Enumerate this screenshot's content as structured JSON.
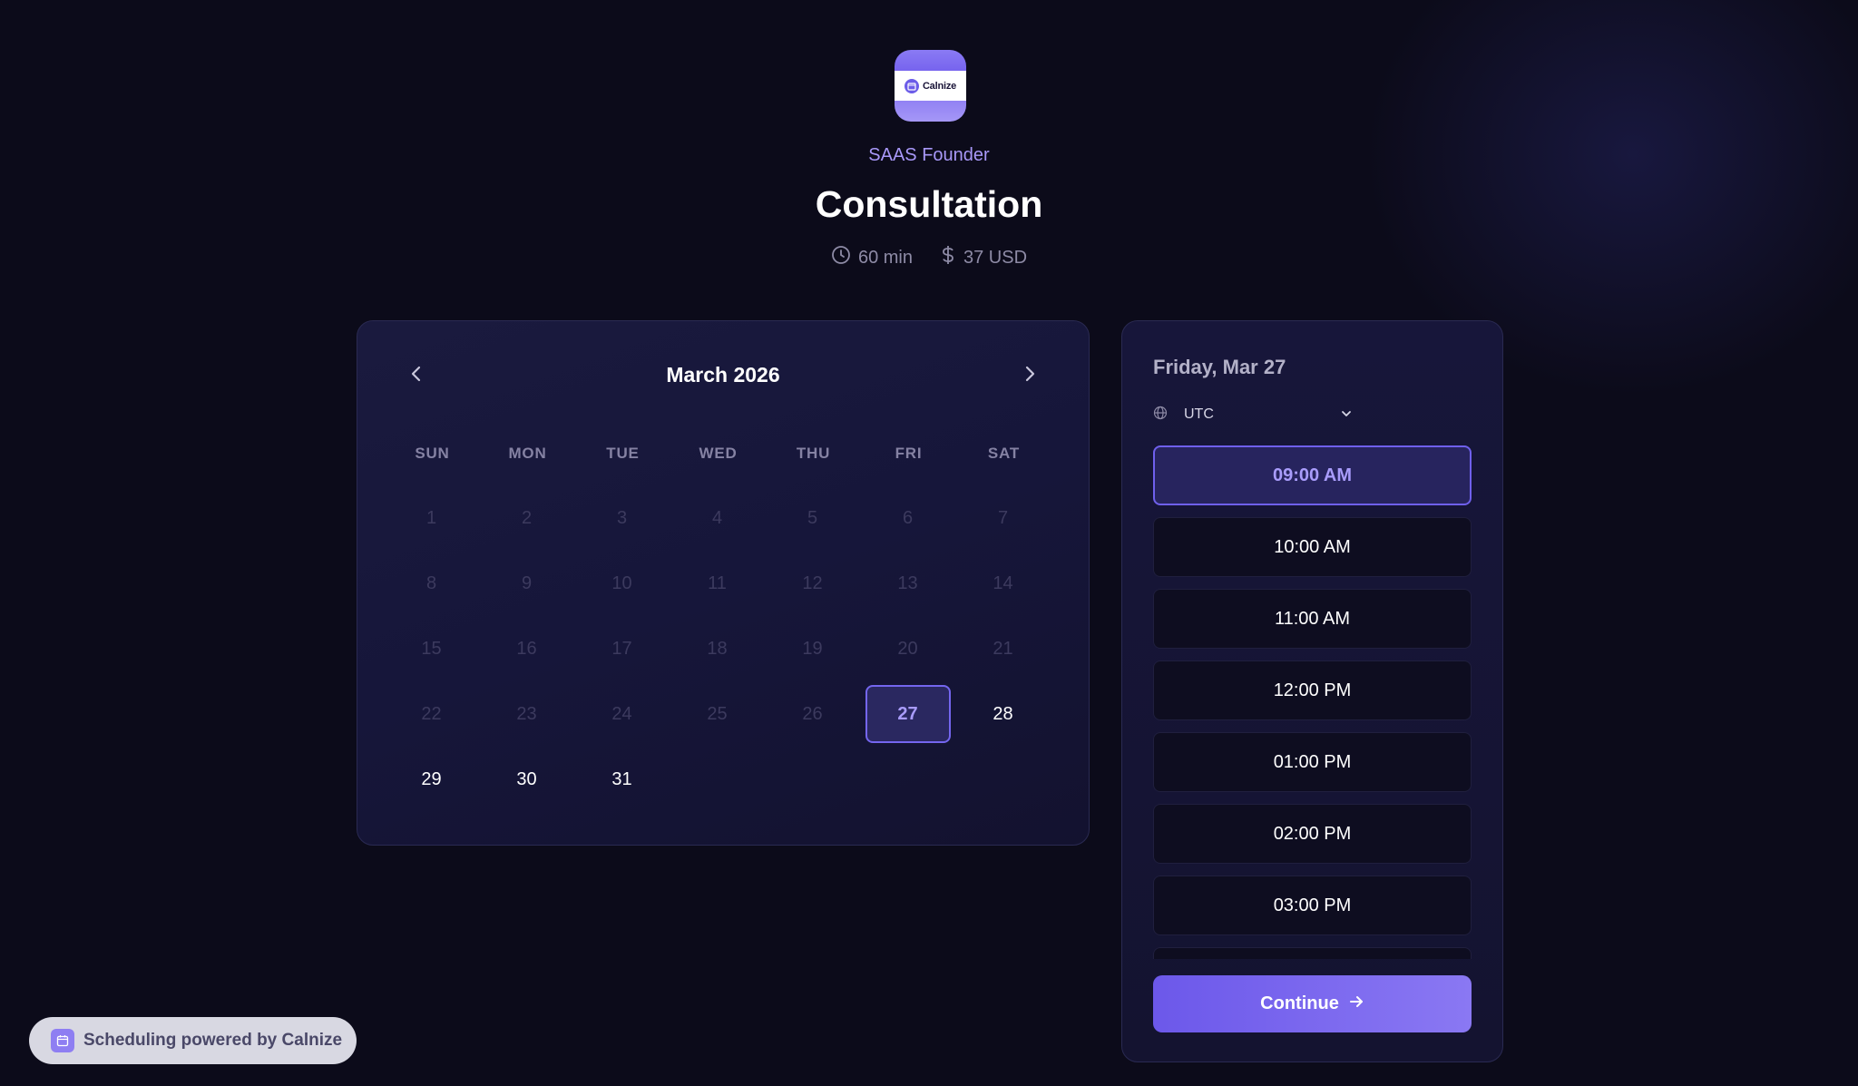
{
  "header": {
    "logo_text": "Calnize",
    "host_name": "SAAS Founder",
    "event_title": "Consultation",
    "duration": "60 min",
    "price": "37 USD"
  },
  "calendar": {
    "month_label": "March 2026",
    "weekdays": [
      "SUN",
      "MON",
      "TUE",
      "WED",
      "THU",
      "FRI",
      "SAT"
    ],
    "days": [
      {
        "label": "1",
        "state": "disabled"
      },
      {
        "label": "2",
        "state": "disabled"
      },
      {
        "label": "3",
        "state": "disabled"
      },
      {
        "label": "4",
        "state": "disabled"
      },
      {
        "label": "5",
        "state": "disabled"
      },
      {
        "label": "6",
        "state": "disabled"
      },
      {
        "label": "7",
        "state": "disabled"
      },
      {
        "label": "8",
        "state": "disabled"
      },
      {
        "label": "9",
        "state": "disabled"
      },
      {
        "label": "10",
        "state": "disabled"
      },
      {
        "label": "11",
        "state": "disabled"
      },
      {
        "label": "12",
        "state": "disabled"
      },
      {
        "label": "13",
        "state": "disabled"
      },
      {
        "label": "14",
        "state": "disabled"
      },
      {
        "label": "15",
        "state": "disabled"
      },
      {
        "label": "16",
        "state": "disabled"
      },
      {
        "label": "17",
        "state": "disabled"
      },
      {
        "label": "18",
        "state": "disabled"
      },
      {
        "label": "19",
        "state": "disabled"
      },
      {
        "label": "20",
        "state": "disabled"
      },
      {
        "label": "21",
        "state": "disabled"
      },
      {
        "label": "22",
        "state": "disabled"
      },
      {
        "label": "23",
        "state": "disabled"
      },
      {
        "label": "24",
        "state": "disabled"
      },
      {
        "label": "25",
        "state": "disabled"
      },
      {
        "label": "26",
        "state": "disabled"
      },
      {
        "label": "27",
        "state": "selected"
      },
      {
        "label": "28",
        "state": "available"
      },
      {
        "label": "29",
        "state": "available"
      },
      {
        "label": "30",
        "state": "available"
      },
      {
        "label": "31",
        "state": "available"
      }
    ]
  },
  "slots_panel": {
    "date_label": "Friday, Mar 27",
    "timezone": "UTC",
    "slots": [
      {
        "label": "09:00 AM",
        "selected": true
      },
      {
        "label": "10:00 AM",
        "selected": false
      },
      {
        "label": "11:00 AM",
        "selected": false
      },
      {
        "label": "12:00 PM",
        "selected": false
      },
      {
        "label": "01:00 PM",
        "selected": false
      },
      {
        "label": "02:00 PM",
        "selected": false
      },
      {
        "label": "03:00 PM",
        "selected": false
      }
    ],
    "continue_label": "Continue"
  },
  "footer": {
    "powered_text": "Scheduling powered by Calnize"
  },
  "colors": {
    "background": "#0c0b1a",
    "accent": "#7466ef",
    "accent_text": "#a99cfb"
  }
}
